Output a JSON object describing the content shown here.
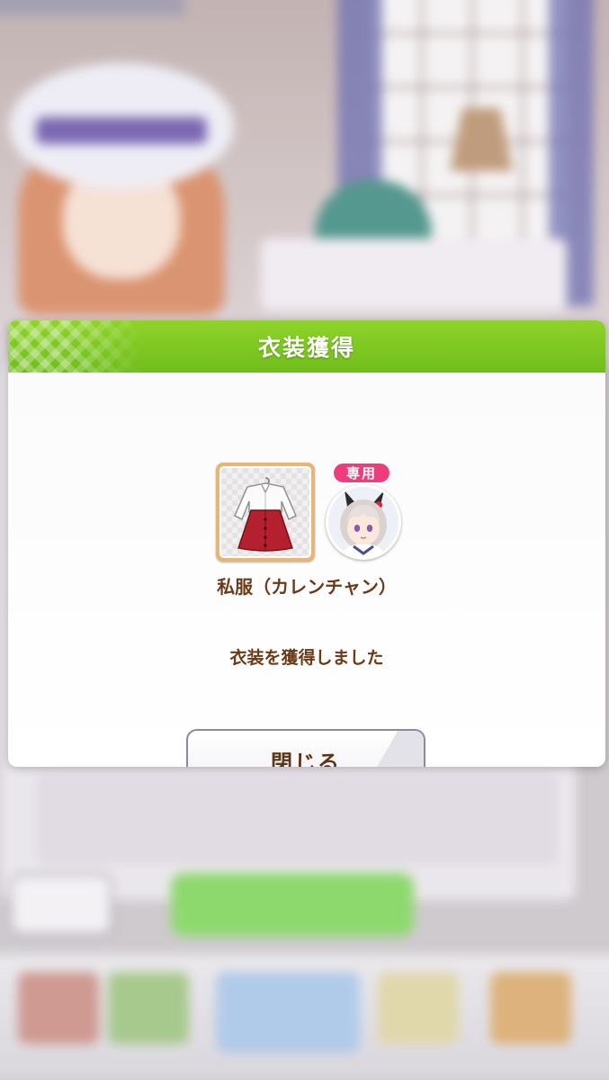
{
  "dialog": {
    "title": "衣装獲得",
    "badge": "専用",
    "item_name": "私服（カレンチャン）",
    "message": "衣装を獲得しました",
    "close_label": "閉じる"
  },
  "icons": {
    "item": "outfit-icon",
    "character": "character-portrait-icon"
  },
  "colors": {
    "header_green": "#7ac521",
    "badge_pink": "#ee3d7d",
    "text_brown": "#6b3a17",
    "frame_gold": "#e7b574"
  }
}
